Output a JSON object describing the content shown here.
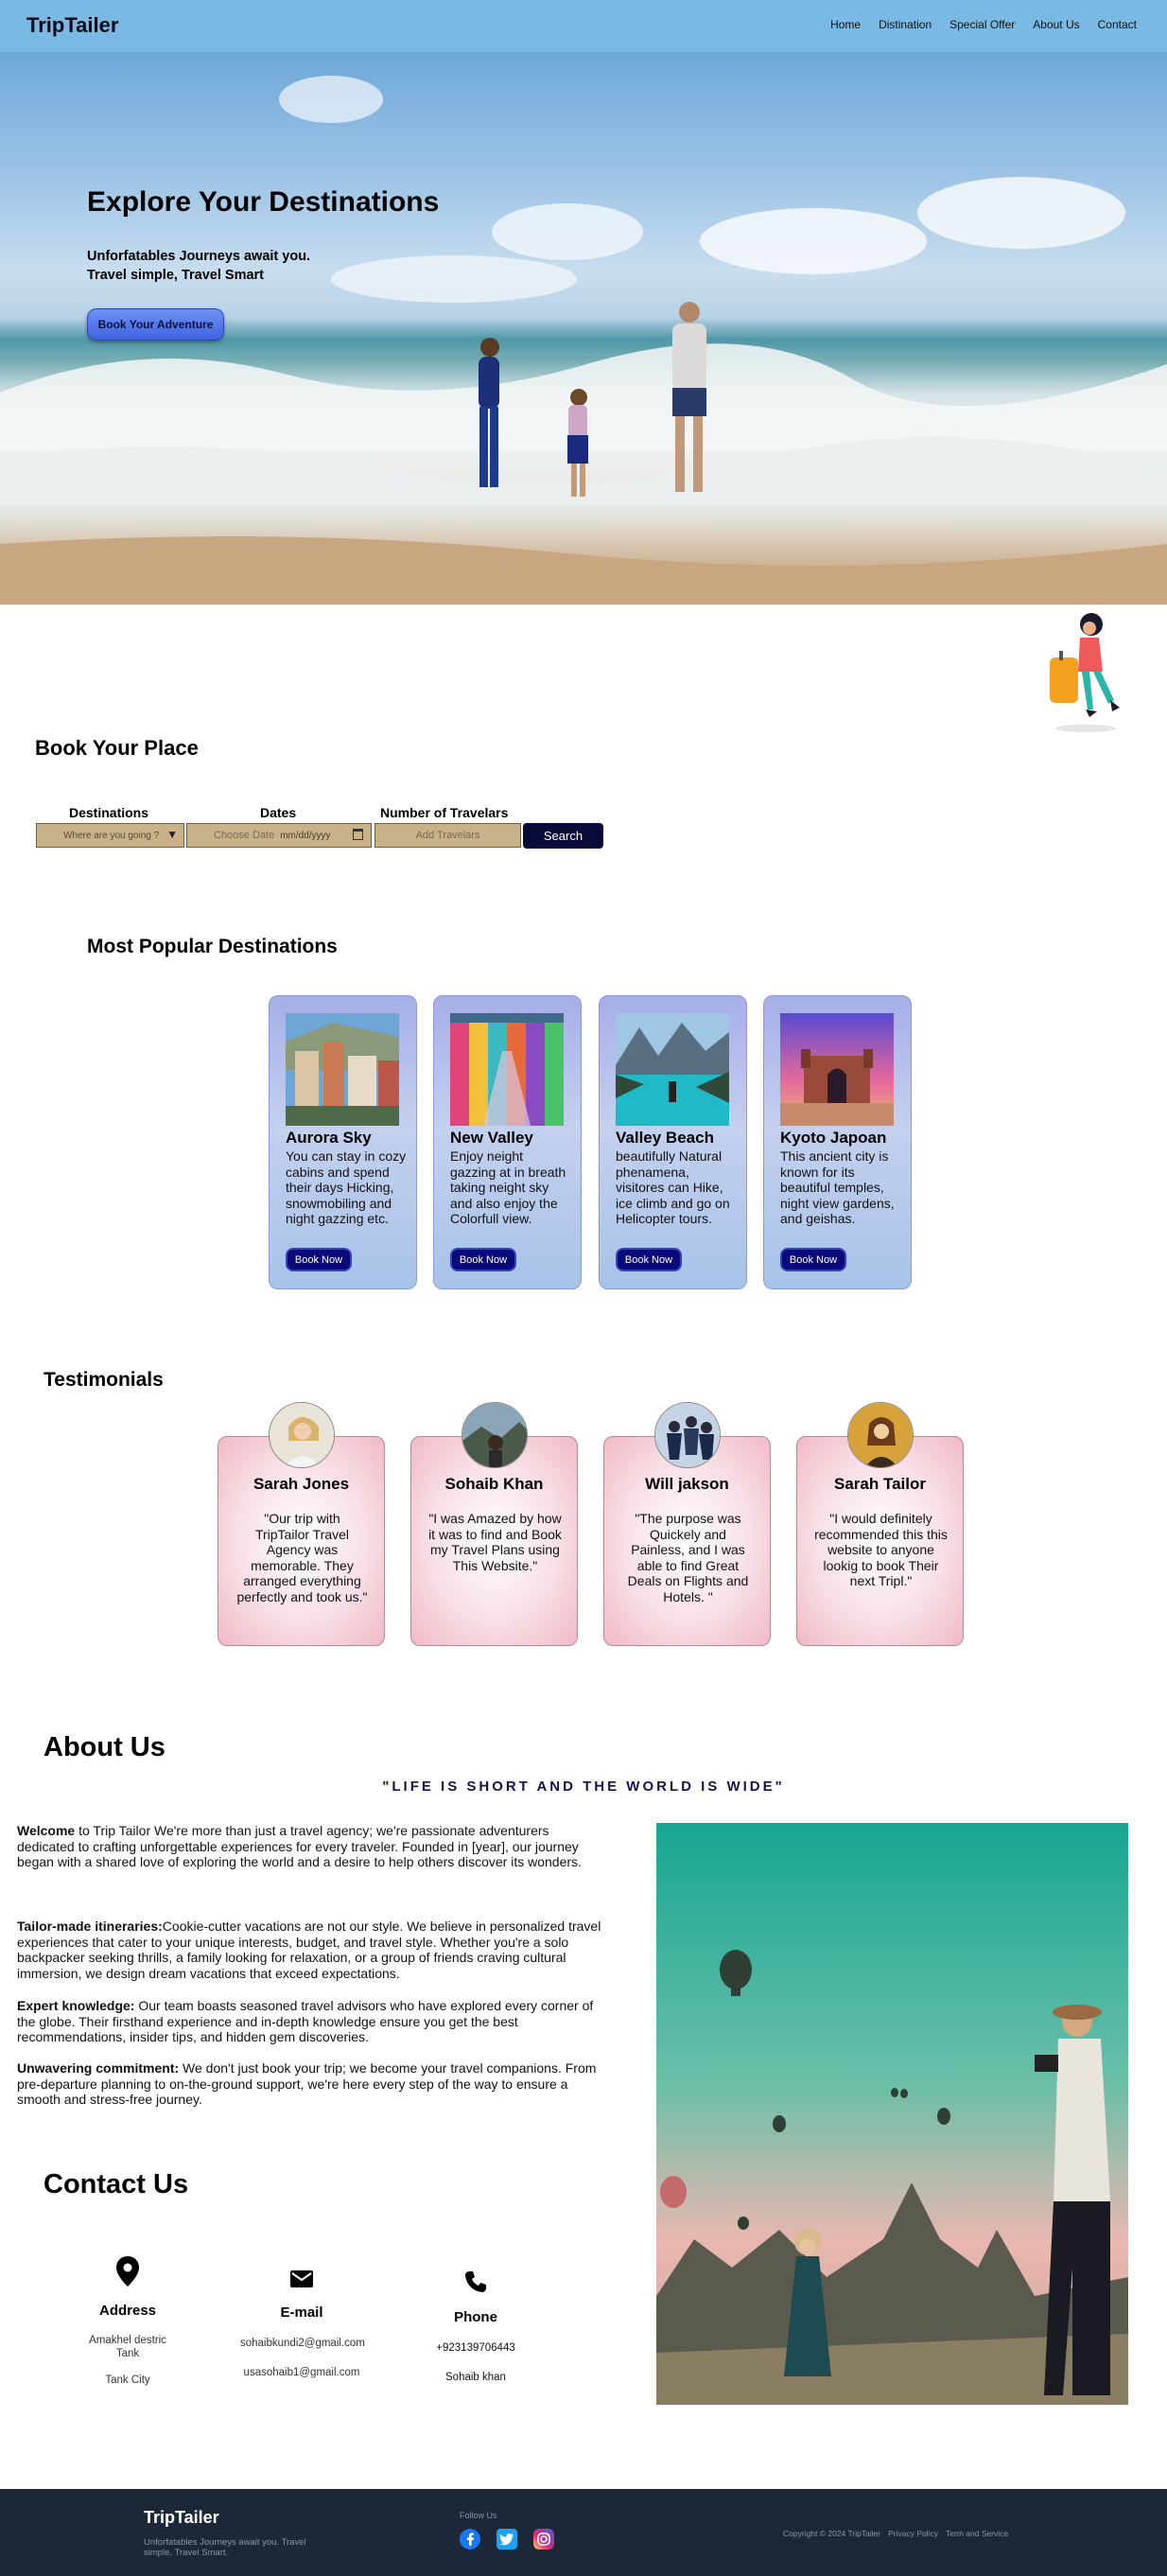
{
  "nav": {
    "brand": "TripTailer",
    "links": [
      "Home",
      "Distination",
      "Special Offer",
      "About Us",
      "Contact"
    ]
  },
  "hero": {
    "title": "Explore Your Destinations",
    "subtitle_line1": "Unforfatables Journeys await you.",
    "subtitle_line2": "Travel simple, Travel Smart",
    "button": "Book Your Adventure"
  },
  "booking": {
    "title": "Book Your Place",
    "labels": {
      "destinations": "Destinations",
      "dates": "Dates",
      "travelers": "Number of Travelars"
    },
    "destination_placeholder": "Where are you going ?",
    "date_placeholder": "Choose Date",
    "date_format": "mm/dd/yyyy",
    "travelers_placeholder": "Add Travelars",
    "search": "Search"
  },
  "popular": {
    "title": "Most Popular Destinations",
    "cards": [
      {
        "name": "Aurora Sky",
        "desc": "You can stay in cozy cabins and spend their days Hicking, snowmobiling and night gazzing etc.",
        "button": "Book Now"
      },
      {
        "name": "New Valley",
        "desc": "Enjoy neight gazzing at in breath taking neight sky and also enjoy the Colorfull view.",
        "button": "Book Now"
      },
      {
        "name": "Valley Beach",
        "desc": "beautifully Natural phenamena, visitores can Hike, ice climb and go on Helicopter tours.",
        "button": "Book Now"
      },
      {
        "name": "Kyoto Japoan",
        "desc": "This ancient city is known for its beautiful temples, night view gardens, and geishas.",
        "button": "Book Now"
      }
    ]
  },
  "testimonials": {
    "title": "Testimonials",
    "items": [
      {
        "name": "Sarah Jones",
        "text": "\"Our trip with TripTailor Travel Agency was memorable. They arranged everything perfectly and took us.\""
      },
      {
        "name": "Sohaib Khan",
        "text": "\"I was Amazed by how it was to find and Book my Travel Plans using This Website.\""
      },
      {
        "name": "Will jakson",
        "text": "\"The purpose was Quickely and Painless, and I was able to find Great Deals on Flights and Hotels. \""
      },
      {
        "name": "Sarah Tailor",
        "text": "\"I would definitely recommended this this website to anyone lookig to book Their next Tripl.\""
      }
    ]
  },
  "about": {
    "title": "About Us",
    "tagline": "\"LIFE IS SHORT AND THE WORLD IS WIDE\"",
    "p1_bold": "Welcome",
    "p1": " to Trip Tailor We're more than just a travel agency; we're passionate adventurers dedicated to crafting unforgettable experiences for every traveler. Founded in [year], our journey began with a shared love of exploring the world and a desire to help others discover its wonders.",
    "p2_bold": "Tailor-made itineraries:",
    "p2": "Cookie-cutter vacations are not our style. We believe in personalized travel experiences that cater to your unique interests, budget, and travel style. Whether you're a solo backpacker seeking thrills, a family looking for relaxation, or a group of friends craving cultural immersion, we design dream vacations that exceed expectations.",
    "p3_bold": "Expert knowledge:",
    "p3": " Our team boasts seasoned travel advisors who have explored every corner of the globe. Their firsthand experience and in-depth knowledge ensure you get the best recommendations, insider tips, and hidden gem discoveries.",
    "p4_bold": "Unwavering commitment:",
    "p4": " We don't just book your trip; we become your travel companions. From pre-departure planning to on-the-ground support, we're here every step of the way to ensure a smooth and stress-free journey."
  },
  "contact": {
    "title": "Contact Us",
    "address_head": "Address",
    "address_line1": "Amakhel destric Tank",
    "address_line2": "Tank City",
    "email_head": "E-mail",
    "email1": "sohaibkundi2@gmail.com",
    "email2": "usasohaib1@gmail.com",
    "phone_head": "Phone",
    "phone": "+923139706443",
    "phone_name": "Sohaib khan"
  },
  "footer": {
    "brand": "TripTailer",
    "sub": "Unforfatables Journeys await you. Travel simple, Travel Smart.",
    "follow": "Follow Us",
    "copyright": "Copyright © 2024 TripTailer",
    "privacy": "Privacy Policy",
    "terms": "Term and Service"
  },
  "icons": [
    "location-pin-icon",
    "mail-icon",
    "phone-icon",
    "facebook-icon",
    "twitter-icon",
    "instagram-icon",
    "calendar-icon",
    "chevron-down-icon"
  ],
  "colors": {
    "nav": "#79b9e3",
    "footer": "#1c2838",
    "button_dark": "#080a3a",
    "card_blue": "#a6aee8",
    "card_pink": "#f0b9c6"
  }
}
